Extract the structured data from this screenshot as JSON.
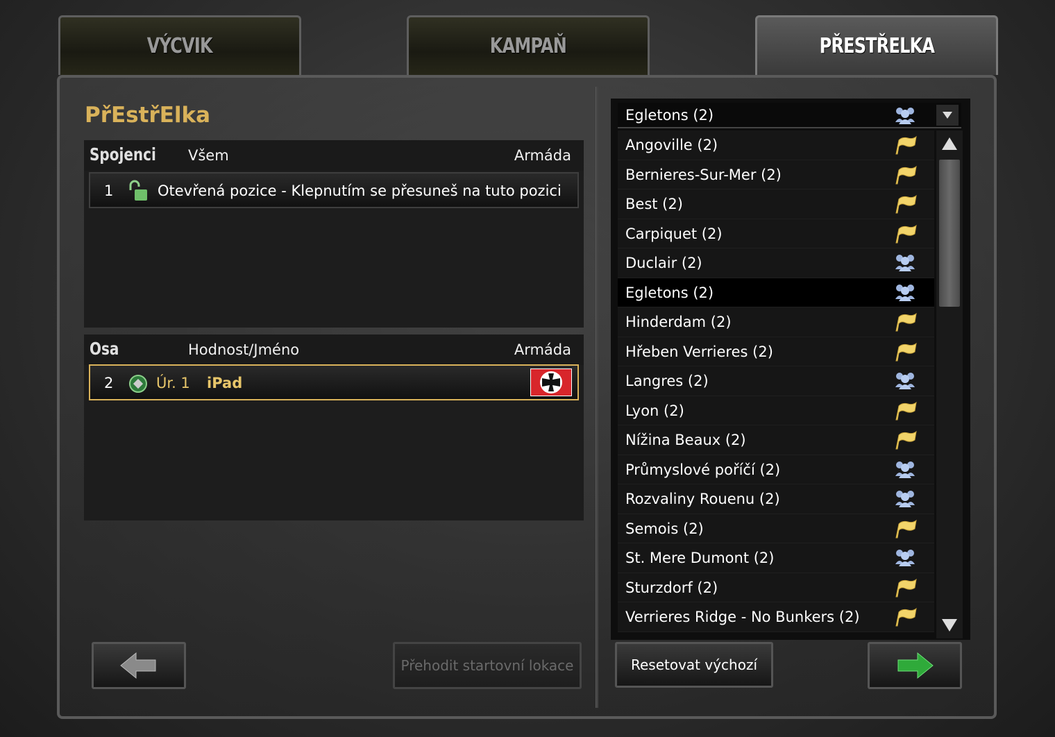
{
  "tabs": [
    {
      "label": "VÝCVIK",
      "active": false
    },
    {
      "label": "KAMPAŇ",
      "active": false
    },
    {
      "label": "PŘESTŘELKA",
      "active": true
    }
  ],
  "page_title": "PřEstřElka",
  "allies": {
    "side": "Spojenci",
    "col_team": "Všem",
    "col_army": "Armáda",
    "slots": [
      {
        "num": "1",
        "text": "Otevřená pozice - Klepnutím se přesuneš na tuto pozici"
      }
    ]
  },
  "axis": {
    "side": "Osa",
    "col_name": "Hodnost/Jméno",
    "col_army": "Armáda",
    "slots": [
      {
        "num": "2",
        "rank": "Úr. 1",
        "player": "iPad",
        "army_icon": "iron-cross-icon"
      }
    ]
  },
  "buttons": {
    "back_icon": "back-arrow-icon",
    "swap_start": "Přehodit startovní lokace",
    "reset": "Resetovat výchozí",
    "next_icon": "forward-arrow-icon"
  },
  "map_select": {
    "selected": "Egletons (2)",
    "selected_icon": "group-icon",
    "maps": [
      {
        "name": "Angoville (2)",
        "icon": "flag-icon"
      },
      {
        "name": "Bernieres-Sur-Mer (2)",
        "icon": "flag-icon"
      },
      {
        "name": "Best (2)",
        "icon": "flag-icon"
      },
      {
        "name": "Carpiquet (2)",
        "icon": "flag-icon"
      },
      {
        "name": "Duclair (2)",
        "icon": "group-icon"
      },
      {
        "name": "Egletons (2)",
        "icon": "group-icon",
        "selected": true
      },
      {
        "name": "Hinderdam (2)",
        "icon": "flag-icon"
      },
      {
        "name": "Hřeben Verrieres (2)",
        "icon": "flag-icon"
      },
      {
        "name": "Langres (2)",
        "icon": "group-icon"
      },
      {
        "name": "Lyon (2)",
        "icon": "flag-icon"
      },
      {
        "name": "Nížina Beaux (2)",
        "icon": "flag-icon"
      },
      {
        "name": "Průmyslové poříčí (2)",
        "icon": "group-icon"
      },
      {
        "name": "Rozvaliny Rouenu (2)",
        "icon": "group-icon"
      },
      {
        "name": "Semois (2)",
        "icon": "flag-icon"
      },
      {
        "name": "St. Mere Dumont (2)",
        "icon": "group-icon"
      },
      {
        "name": "Sturzdorf (2)",
        "icon": "flag-icon"
      },
      {
        "name": "Verrieres Ridge - No Bunkers (2)",
        "icon": "flag-icon"
      }
    ]
  },
  "colors": {
    "accent": "#d9b25a",
    "flag_red": "#d8262b",
    "group_icon": "#9fb6e0",
    "flag_icon": "#f2d46a"
  }
}
